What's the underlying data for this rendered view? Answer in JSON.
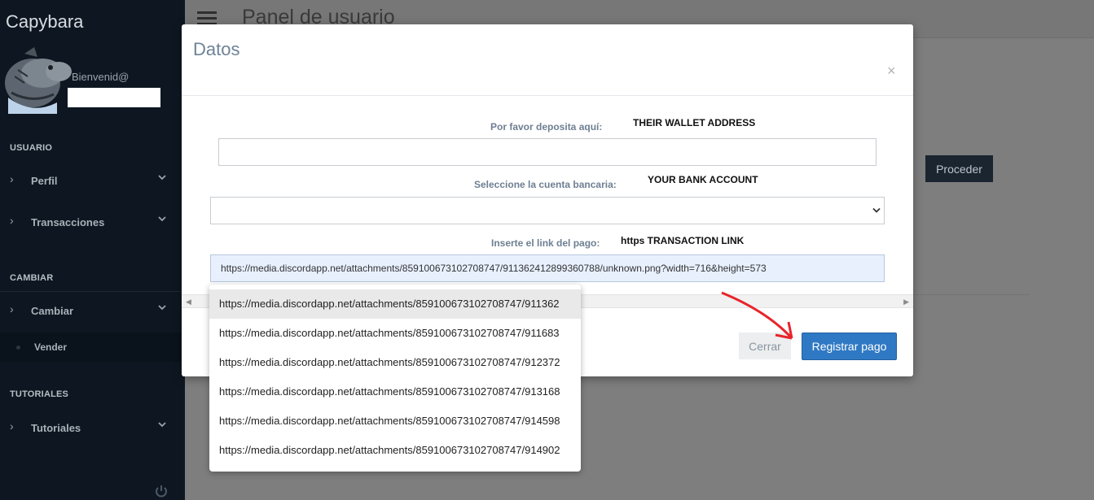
{
  "sidebar": {
    "brand": "Capybara",
    "welcome": "Bienvenid@",
    "sections": {
      "usuario": "USUARIO",
      "cambiar": "CAMBIAR",
      "tutoriales": "TUTORIALES"
    },
    "items": {
      "perfil": "Perfil",
      "transacciones": "Transacciones",
      "cambiar": "Cambiar",
      "vender": "Vender",
      "tutoriales": "Tutoriales"
    }
  },
  "page": {
    "title": "Panel de usuario",
    "proceder_label": "Proceder"
  },
  "modal": {
    "title": "Datos",
    "close_glyph": "×",
    "deposit_label": "Por favor deposita aquí:",
    "deposit_annotation": "THEIR WALLET ADDRESS",
    "bank_label": "Seleccione la cuenta bancaria:",
    "bank_annotation": "YOUR BANK ACCOUNT",
    "link_label": "Inserte el link del pago:",
    "link_annotation": "https TRANSACTION LINK",
    "link_value": "https://media.discordapp.net/attachments/859100673102708747/911362412899360788/unknown.png?width=716&height=573",
    "cerrar_label": "Cerrar",
    "registrar_label": "Registrar pago"
  },
  "autocomplete": [
    "https://media.discordapp.net/attachments/859100673102708747/911362",
    "https://media.discordapp.net/attachments/859100673102708747/911683",
    "https://media.discordapp.net/attachments/859100673102708747/912372",
    "https://media.discordapp.net/attachments/859100673102708747/913168",
    "https://media.discordapp.net/attachments/859100673102708747/914598",
    "https://media.discordapp.net/attachments/859100673102708747/914902"
  ],
  "colors": {
    "sidebar_bg": "#0e1721",
    "primary_button": "#2f79c4",
    "annotation_arrow": "#e8242a"
  }
}
